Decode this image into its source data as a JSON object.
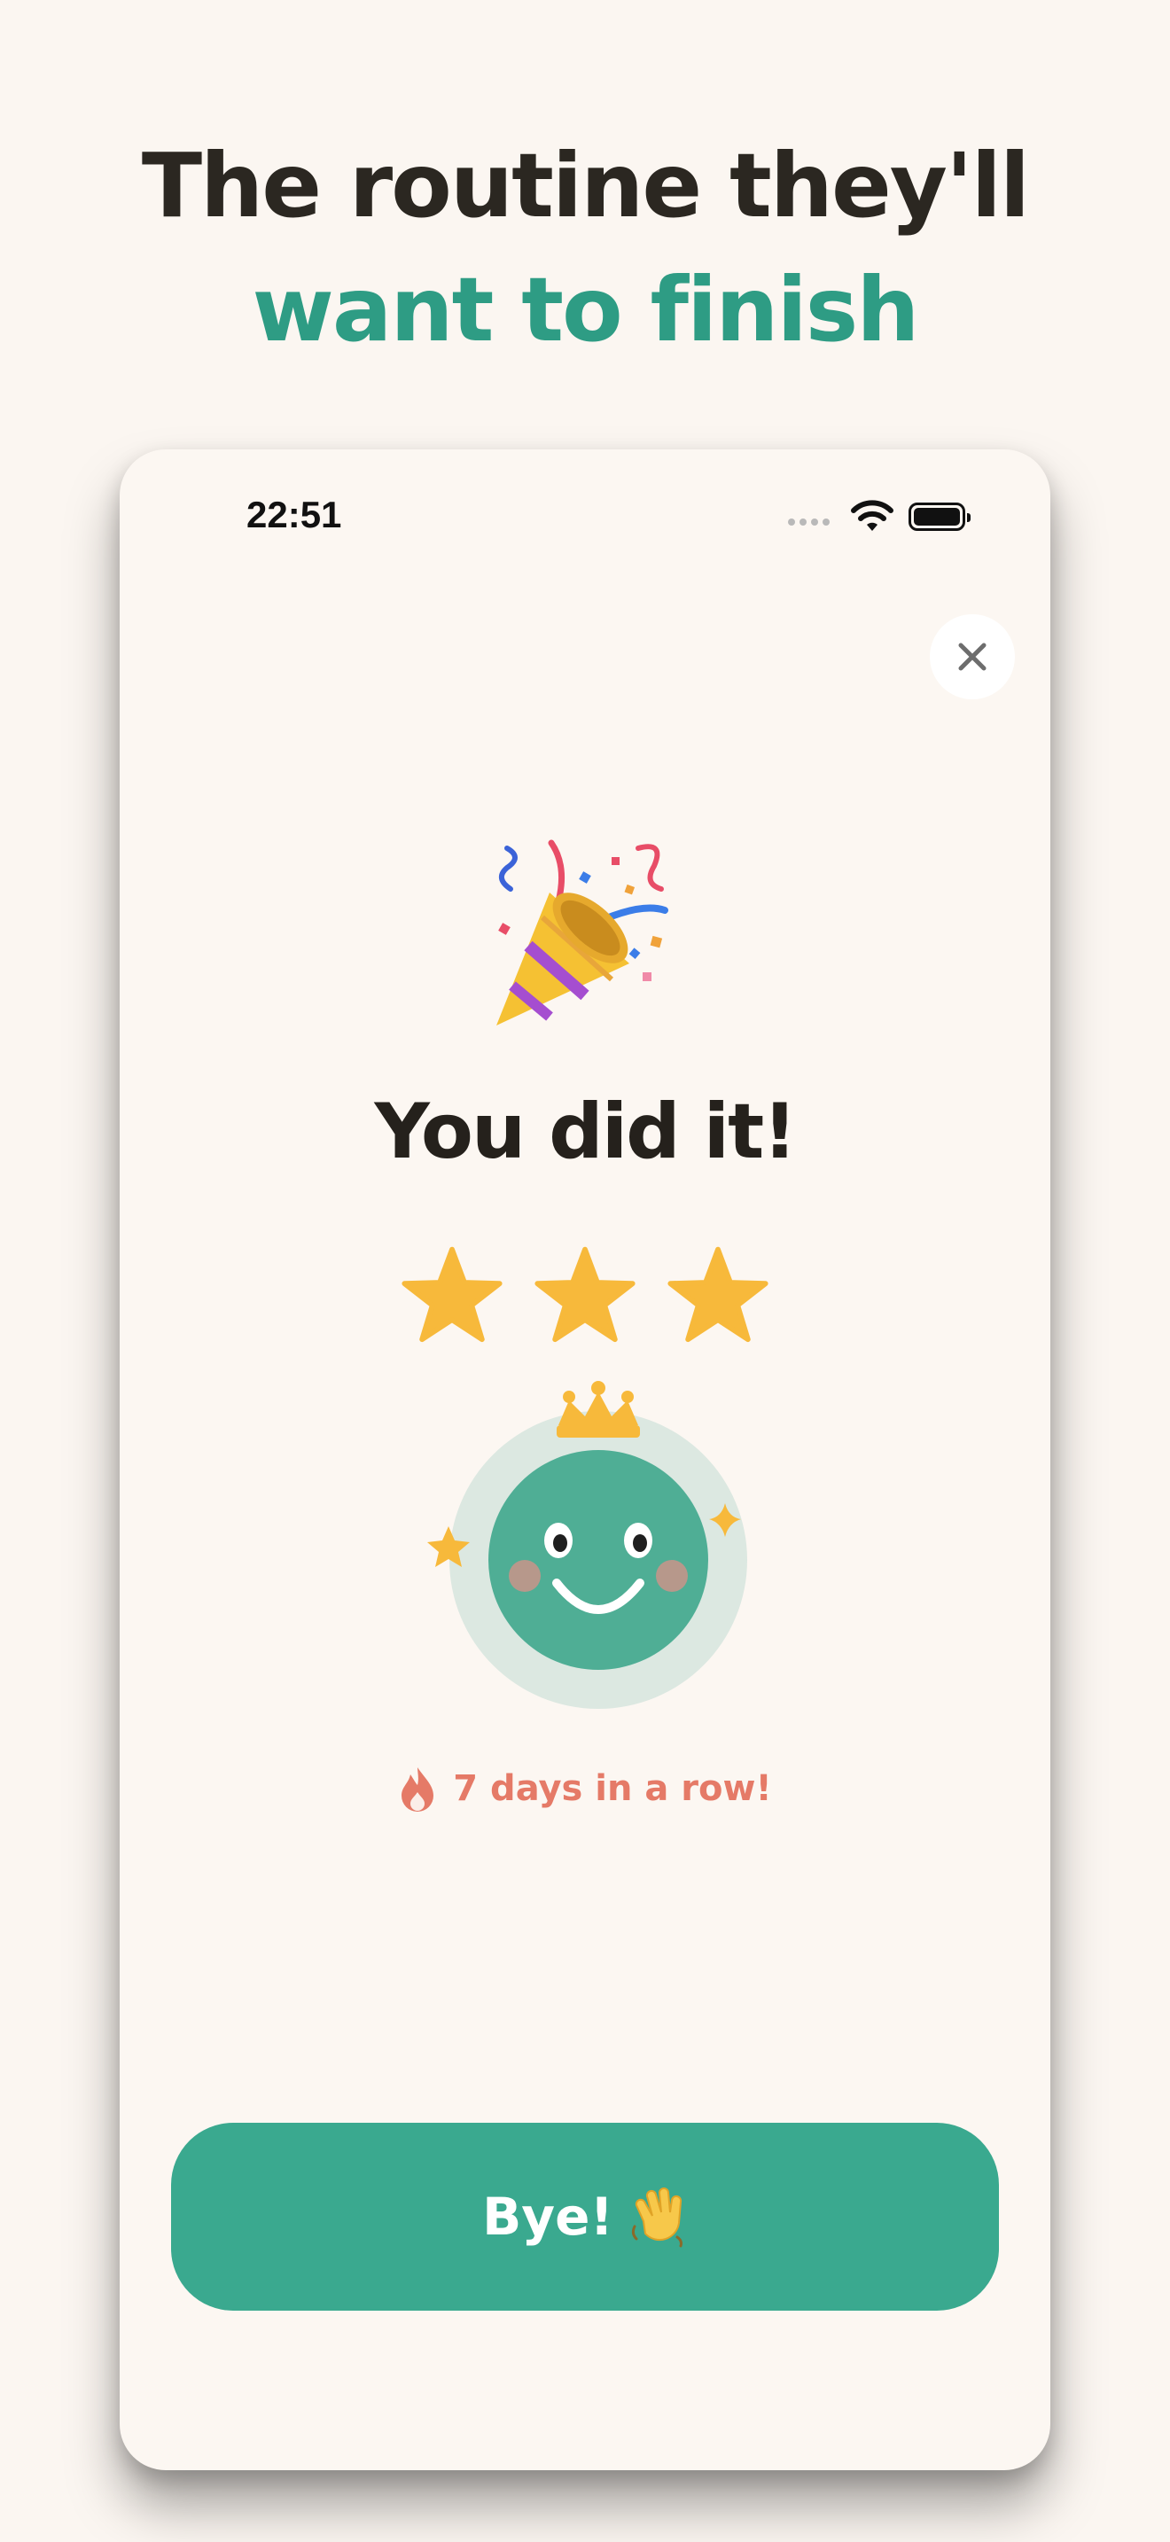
{
  "marketing": {
    "headline_line1": "The routine they'll",
    "headline_line2": "want to finish"
  },
  "status_bar": {
    "time": "22:51",
    "icons": [
      "signal-dots-icon",
      "wifi-icon",
      "battery-icon"
    ]
  },
  "celebration": {
    "close_icon": "close-icon",
    "party_icon": "party-popper-icon",
    "title": "You did it!",
    "stars_earned": 3,
    "stars_total": 3,
    "mascot_icon": "crowned-smiley-mascot-icon",
    "streak_icon": "flame-icon",
    "streak_text": "7 days in a row!",
    "button_label": "Bye!",
    "button_icon": "waving-hand-icon"
  },
  "colors": {
    "background": "#fbf6f1",
    "accent_green": "#3aa98f",
    "headline_green": "#2e9c84",
    "star_yellow": "#f7b93b",
    "streak_coral": "#e57a67"
  }
}
